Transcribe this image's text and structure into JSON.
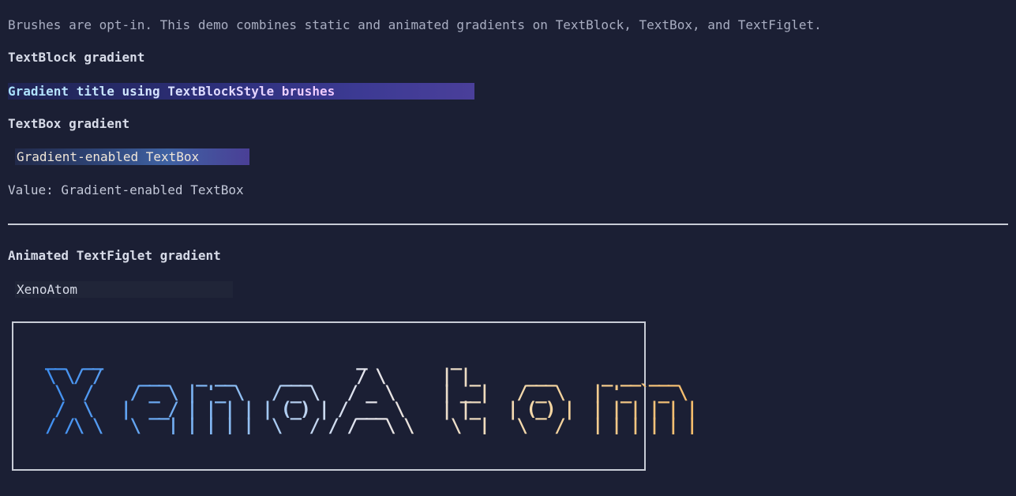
{
  "intro": "Brushes are opt-in. This demo combines static and animated gradients on TextBlock, TextBox, and TextFiglet.",
  "textblock": {
    "heading": "TextBlock gradient",
    "title": "Gradient title using TextBlockStyle brushes"
  },
  "textbox": {
    "heading": "TextBox gradient",
    "value": "Gradient-enabled TextBox",
    "value_line": "Value: Gradient-enabled TextBox"
  },
  "figlet": {
    "heading": "Animated TextFiglet gradient",
    "input_value": "XenoAtom",
    "art": " __  __                           _         _                         \n \\ \\/ /    ___   _ __     ___     / \\      | |_     ___     _ __ ___  \n  \\  /    / _ \\ | '_ \\   / _ \\   / _ \\     | __|   / _ \\   | '_ ` _ \\ \n  /  \\   |  __/ | | | | | (_) | / ___ \\    | |_   | (_) |  | | | | | |\n /_/\\_\\   \\___| |_| |_|  \\___/ /_/   \\_\\    \\__|   \\___/   |_| |_| |_|"
  },
  "colors": {
    "background": "#1b1f34",
    "text": "#c3c8d8",
    "figlet_start": "#3b8cf0",
    "figlet_end": "#f4bb6a"
  }
}
